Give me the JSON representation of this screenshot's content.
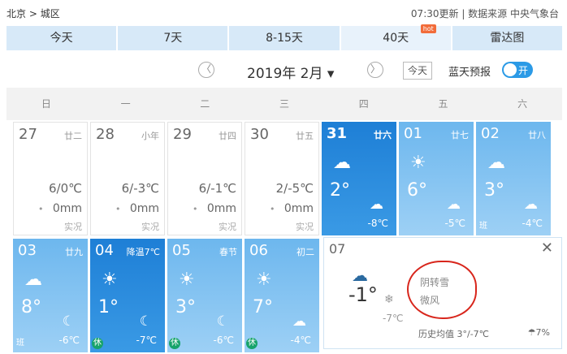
{
  "location": {
    "city": "北京",
    "sep": ">",
    "district": "城区"
  },
  "source": "07:30更新 | 数据来源 中央气象台",
  "tabs": [
    "今天",
    "7天",
    "8-15天",
    "40天",
    "雷达图"
  ],
  "hot_badge": "hot",
  "nav": {
    "prev": "〈",
    "next": "〉",
    "month": "2019年 2月 ▾",
    "today": "今天",
    "blue_label": "蓝天预报",
    "toggle": "开"
  },
  "weekdays": [
    "日",
    "一",
    "二",
    "三",
    "四",
    "五",
    "六"
  ],
  "row1": [
    {
      "day": "27",
      "lunar": "廿二",
      "range": "6/0℃",
      "rain": "0mm",
      "actual": "实况"
    },
    {
      "day": "28",
      "lunar": "小年",
      "range": "6/-3℃",
      "rain": "0mm",
      "actual": "实况"
    },
    {
      "day": "29",
      "lunar": "廿四",
      "range": "6/-1℃",
      "rain": "0mm",
      "actual": "实况"
    },
    {
      "day": "30",
      "lunar": "廿五",
      "range": "2/-5℃",
      "rain": "0mm",
      "actual": "实况"
    },
    {
      "day": "31",
      "lunar": "廿六",
      "temp": "2°",
      "low": "-8℃"
    },
    {
      "day": "01",
      "lunar": "廿七",
      "temp": "6°",
      "low": "-5℃"
    },
    {
      "day": "02",
      "lunar": "廿八",
      "temp": "3°",
      "low": "-4℃",
      "badge": "班"
    }
  ],
  "row2": [
    {
      "day": "03",
      "lunar": "廿九",
      "temp": "8°",
      "low": "-6℃",
      "badge": "班"
    },
    {
      "day": "04",
      "lunar": "降温7℃",
      "temp": "1°",
      "low": "-7℃",
      "badge": "休"
    },
    {
      "day": "05",
      "lunar": "春节",
      "temp": "3°",
      "low": "-6℃",
      "badge": "休"
    },
    {
      "day": "06",
      "lunar": "初二",
      "temp": "7°",
      "low": "-4℃",
      "badge": "休"
    }
  ],
  "detail": {
    "day": "07",
    "temp": "-1°",
    "low": "-7℃",
    "weather": "阴转雪",
    "wind": "微风",
    "history": "历史均值 3°/-7℃",
    "precip": "7%"
  },
  "colors": {
    "tab_bg": "#d7e9f8",
    "light_cell": "#6db7ee",
    "dark_cell": "#1e7fd6",
    "toggle": "#2b9ae6",
    "red_mark": "#d8261c"
  }
}
